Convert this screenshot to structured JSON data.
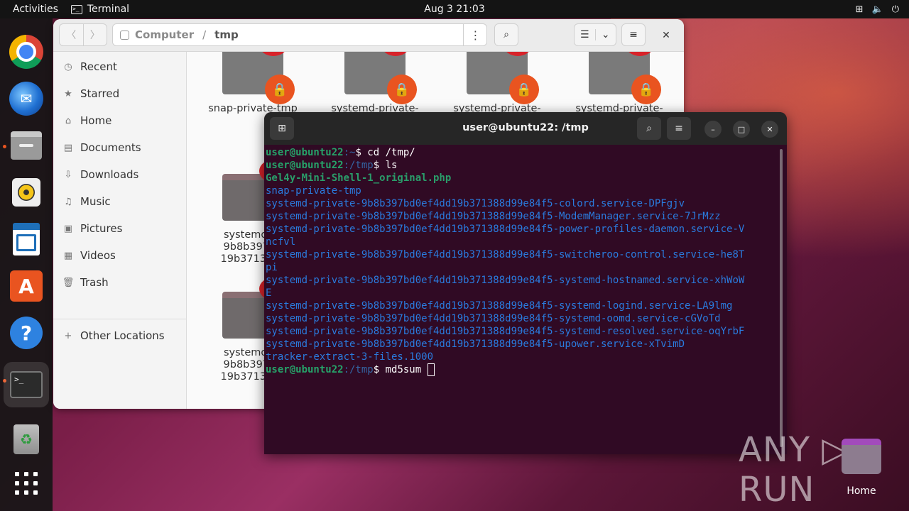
{
  "topbar": {
    "activities": "Activities",
    "app_name": "Terminal",
    "clock": "Aug 3  21:03"
  },
  "dock": {
    "items": [
      "chrome-icon",
      "thunderbird-icon",
      "files-icon",
      "rhythmbox-icon",
      "libreoffice-writer-icon",
      "app-center-icon",
      "help-icon",
      "terminal-icon",
      "trash-icon",
      "show-apps-icon"
    ]
  },
  "files": {
    "path": {
      "root": "Computer",
      "current": "tmp"
    },
    "sidebar": [
      {
        "label": "Recent",
        "icon": "clock-icon"
      },
      {
        "label": "Starred",
        "icon": "star-icon"
      },
      {
        "label": "Home",
        "icon": "home-icon"
      },
      {
        "label": "Documents",
        "icon": "document-icon"
      },
      {
        "label": "Downloads",
        "icon": "download-icon"
      },
      {
        "label": "Music",
        "icon": "music-icon"
      },
      {
        "label": "Pictures",
        "icon": "picture-icon"
      },
      {
        "label": "Videos",
        "icon": "video-icon"
      },
      {
        "label": "Trash",
        "icon": "trash-icon"
      },
      {
        "label": "Other Locations",
        "icon": "plus-icon"
      }
    ],
    "tiles": [
      {
        "label": "snap-private-tmp"
      },
      {
        "label": "systemd-private-"
      },
      {
        "label": "systemd-private-"
      },
      {
        "label": "systemd-private-"
      },
      {
        "label": "systemd-pr",
        "line2": "9b8b397bd",
        "line3": "19b371388c"
      },
      {
        "label": "systemd-pr",
        "line2": "9b8b397bd",
        "line3": "19b371388c"
      }
    ]
  },
  "terminal": {
    "title": "user@ubuntu22: /tmp",
    "prompt_user": "user@ubuntu22",
    "lines": [
      {
        "path": ":~",
        "cmd": "$ cd /tmp/"
      },
      {
        "path": ":/tmp",
        "cmd": "$ ls"
      }
    ],
    "ls_file": "Gel4y-Mini-Shell-1_original.php",
    "ls_dirs": [
      "snap-private-tmp",
      "systemd-private-9b8b397bd0ef4dd19b371388d99e84f5-colord.service-DPFgjv",
      "systemd-private-9b8b397bd0ef4dd19b371388d99e84f5-ModemManager.service-7JrMzz",
      "systemd-private-9b8b397bd0ef4dd19b371388d99e84f5-power-profiles-daemon.service-V",
      "ncfvl",
      "systemd-private-9b8b397bd0ef4dd19b371388d99e84f5-switcheroo-control.service-he8T",
      "pi",
      "systemd-private-9b8b397bd0ef4dd19b371388d99e84f5-systemd-hostnamed.service-xhWoW",
      "E",
      "systemd-private-9b8b397bd0ef4dd19b371388d99e84f5-systemd-logind.service-LA9lmg",
      "systemd-private-9b8b397bd0ef4dd19b371388d99e84f5-systemd-oomd.service-cGVoTd",
      "systemd-private-9b8b397bd0ef4dd19b371388d99e84f5-systemd-resolved.service-oqYrbF",
      "systemd-private-9b8b397bd0ef4dd19b371388d99e84f5-upower.service-xTvimD",
      "tracker-extract-3-files.1000"
    ],
    "current": {
      "path": ":/tmp",
      "cmd": "$ md5sum "
    }
  },
  "desktop": {
    "home_label": "Home",
    "watermark": "ANY ▷ RUN"
  }
}
